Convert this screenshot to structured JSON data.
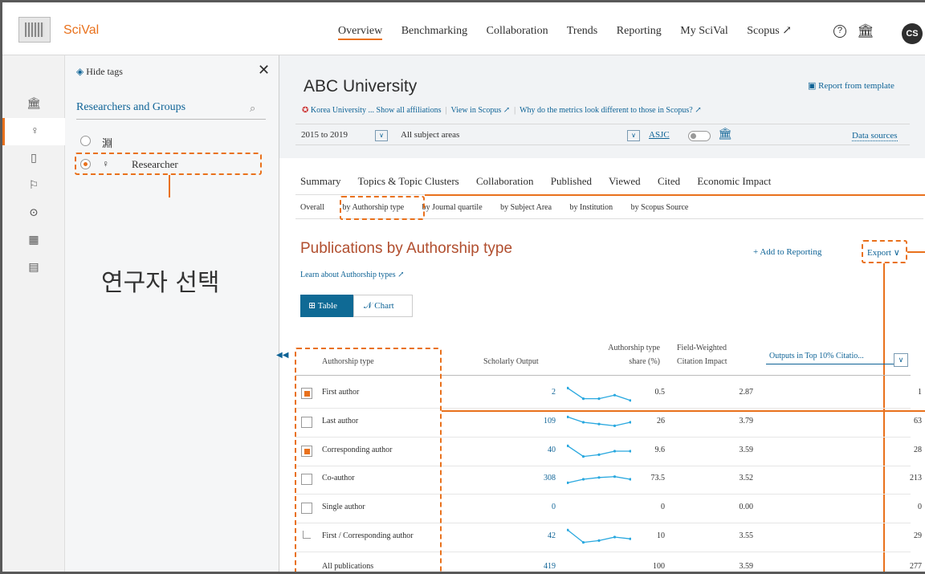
{
  "app": {
    "brand": "SciVal",
    "nav": [
      "Overview",
      "Benchmarking",
      "Collaboration",
      "Trends",
      "Reporting",
      "My SciVal",
      "Scopus ↗"
    ],
    "user_initials": "CS"
  },
  "tag_panel": {
    "hide_tags": "Hide tags",
    "title": "Researchers and Groups",
    "options": [
      {
        "label": "淵",
        "selected": false
      },
      {
        "label": "Researcher",
        "selected": true
      }
    ],
    "annotation": "연구자 선택"
  },
  "header": {
    "entity_name": "ABC University",
    "report_from_template": "Report from template",
    "affiliation": "Korea University ... Show all affiliations",
    "view_in_scopus": "View in Scopus ↗",
    "why_metrics": "Why do the metrics look different to those in Scopus? ↗",
    "period": "2015 to 2019",
    "subjects": "All subject areas",
    "asjc": "ASJC",
    "data_sources": "Data sources"
  },
  "tabs": [
    "Summary",
    "Topics & Topic Clusters",
    "Collaboration",
    "Published",
    "Viewed",
    "Cited",
    "Economic Impact"
  ],
  "subtabs": [
    "Overall",
    "by Authorship type",
    "by Journal quartile",
    "by Subject Area",
    "by Institution",
    "by Scopus Source"
  ],
  "section": {
    "title": "Publications by Authorship type",
    "add_to_reporting": "+ Add to Reporting",
    "export": "Export ∨",
    "learn": "Learn about Authorship types ↗",
    "btn_table": "Table",
    "btn_chart": "Chart"
  },
  "table": {
    "headers": {
      "type": "Authorship type",
      "output": "Scholarly Output",
      "share_1": "Authorship type",
      "share_2": "share (%)",
      "fwci_1": "Field-Weighted",
      "fwci_2": "Citation Impact",
      "top10": "Outputs in Top 10% Citatio..."
    },
    "rows": [
      {
        "label": "First author",
        "output": "2",
        "share": "0.5",
        "fwci": "2.87",
        "top10": "1",
        "checked": true,
        "spark": [
          0.2,
          0.8,
          0.8,
          0.6,
          0.9
        ]
      },
      {
        "label": "Last author",
        "output": "109",
        "share": "26",
        "fwci": "3.79",
        "top10": "63",
        "checked": false,
        "spark": [
          0.2,
          0.5,
          0.6,
          0.7,
          0.5
        ]
      },
      {
        "label": "Corresponding author",
        "output": "40",
        "share": "9.6",
        "fwci": "3.59",
        "top10": "28",
        "checked": true,
        "spark": [
          0.2,
          0.8,
          0.7,
          0.5,
          0.5
        ]
      },
      {
        "label": "Co-author",
        "output": "308",
        "share": "73.5",
        "fwci": "3.52",
        "top10": "213",
        "checked": false,
        "spark": [
          0.7,
          0.5,
          0.4,
          0.35,
          0.5
        ]
      },
      {
        "label": "Single author",
        "output": "0",
        "share": "0",
        "fwci": "0.00",
        "top10": "0",
        "checked": false,
        "spark": []
      },
      {
        "label": "First / Corresponding author",
        "output": "42",
        "share": "10",
        "fwci": "3.55",
        "top10": "29",
        "checked": null,
        "spark": [
          0.1,
          0.8,
          0.7,
          0.5,
          0.6
        ]
      },
      {
        "label": "All publications",
        "output": "419",
        "share": "100",
        "fwci": "3.59",
        "top10": "277",
        "checked": null,
        "spark": []
      }
    ]
  }
}
